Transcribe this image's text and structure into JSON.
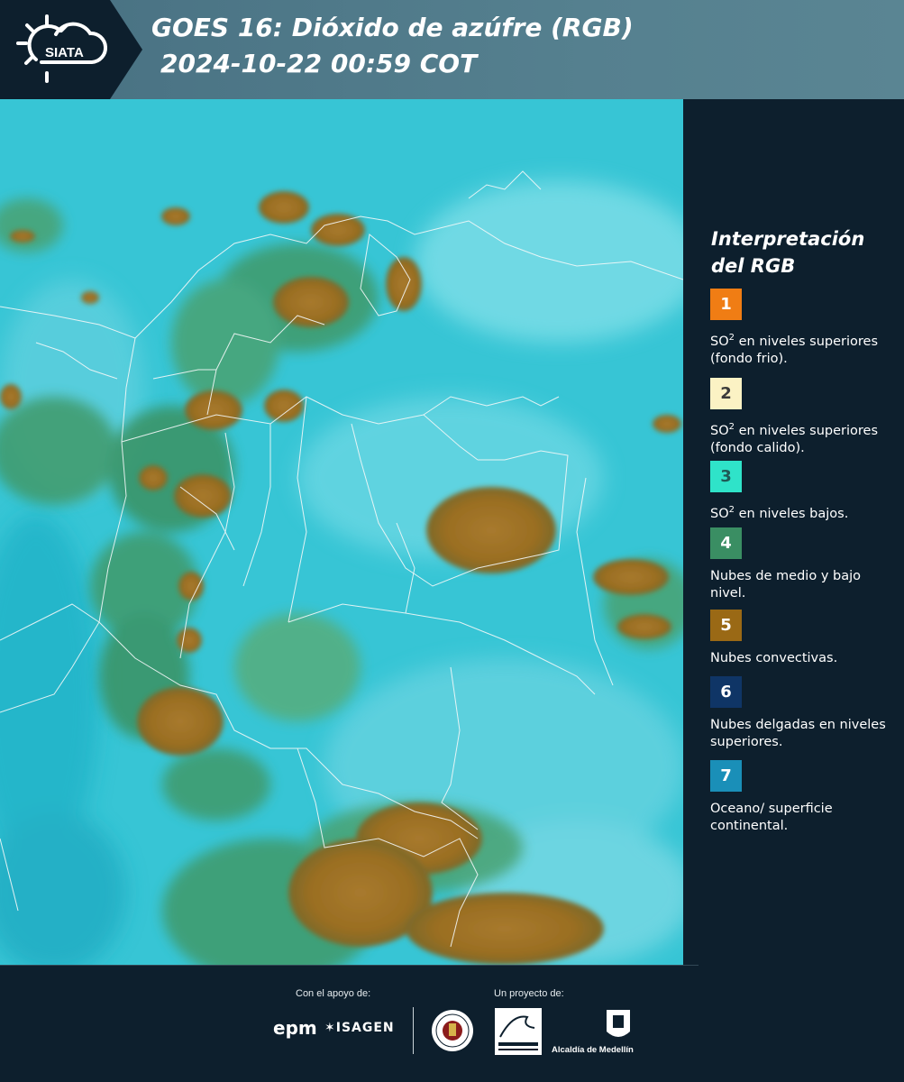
{
  "header": {
    "logo_text": "SIATA",
    "title_line1": "GOES 16: Dióxido de azúfre (RGB)",
    "title_line2": "2024-10-22 00:59 COT"
  },
  "legend": {
    "title": "Interpretación del RGB",
    "items": [
      {
        "number": "1",
        "label_prefix": "SO",
        "sup": "2",
        "label_suffix": " en niveles superiores (fondo frio).",
        "color": "#f07d14",
        "text_color": "#ffffff"
      },
      {
        "number": "2",
        "label_prefix": "SO",
        "sup": "2",
        "label_suffix": " en niveles superiores (fondo calido).",
        "color": "#fbf2c4",
        "text_color": "#3a3a3a"
      },
      {
        "number": "3",
        "label_prefix": "SO",
        "sup": "2",
        "label_suffix": " en niveles bajos.",
        "color": "#2fe3c9",
        "text_color": "#1f5a56"
      },
      {
        "number": "4",
        "label_prefix": "",
        "sup": "",
        "label_suffix": "Nubes de medio y bajo nivel.",
        "color": "#3a8e63",
        "text_color": "#ffffff"
      },
      {
        "number": "5",
        "label_prefix": "",
        "sup": "",
        "label_suffix": "Nubes convectivas.",
        "color": "#9a6915",
        "text_color": "#ffffff"
      },
      {
        "number": "6",
        "label_prefix": "",
        "sup": "",
        "label_suffix": "Nubes delgadas en niveles superiores.",
        "color": "#0f3566",
        "text_color": "#ffffff"
      },
      {
        "number": "7",
        "label_prefix": "",
        "sup": "",
        "label_suffix": "Oceano/ superficie continental.",
        "color": "#1a8fb8",
        "text_color": "#ffffff"
      }
    ]
  },
  "footer": {
    "support_label": "Con el apoyo de:",
    "project_label": "Un proyecto de:",
    "sponsor_logos": [
      "epm",
      "ISAGEN"
    ],
    "partner_logos": [
      "Área Metropolitana Valle de Aburrá",
      "Alcaldía de Medellín"
    ],
    "alcaldia_label": "Alcaldía de Medellín"
  },
  "colors": {
    "background": "#0d1f2d",
    "header_band": "#4f7a8a",
    "ocean_cyan": "#35c6d6",
    "convective_brown": "#9a6915",
    "low_cloud_green": "#3a8e63"
  }
}
